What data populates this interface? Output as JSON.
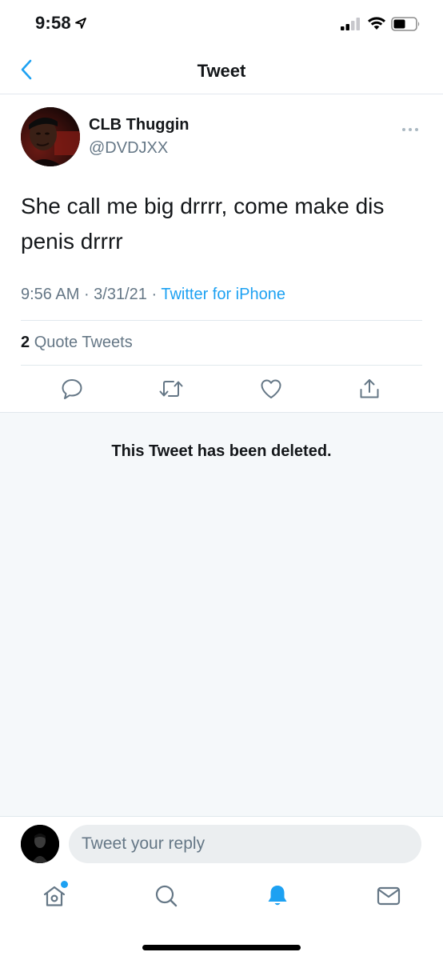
{
  "status_bar": {
    "time": "9:58",
    "icons": [
      "location-arrow-icon",
      "signal-icon",
      "wifi-icon",
      "battery-icon"
    ]
  },
  "header": {
    "title": "Tweet",
    "back_icon": "chevron-left-icon"
  },
  "tweet": {
    "author": {
      "display_name": "CLB Thuggin",
      "handle": "@DVDJXX"
    },
    "text": "She call me big drrrr, come make dis penis drrrr",
    "time": "9:56 AM",
    "separator": " · ",
    "date": "3/31/21",
    "source": "Twitter for iPhone",
    "quote_count": "2",
    "quote_label": "Quote Tweets",
    "actions": [
      "reply-icon",
      "retweet-icon",
      "like-icon",
      "share-icon"
    ]
  },
  "deleted_notice": "This Tweet has been deleted.",
  "reply": {
    "placeholder": "Tweet your reply"
  },
  "tab_bar": {
    "tabs": [
      "home-icon",
      "search-icon",
      "notifications-icon",
      "messages-icon"
    ],
    "active": "notifications-icon"
  },
  "colors": {
    "accent": "#1da1f2",
    "secondary_text": "#657786",
    "divider": "#e1e8ed",
    "deleted_background": "#f5f8fa"
  }
}
